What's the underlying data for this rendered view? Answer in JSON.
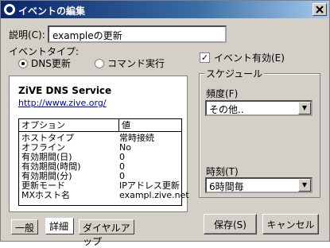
{
  "window": {
    "title": "イベントの編集"
  },
  "description": {
    "label": "説明(C):",
    "value": "exampleの更新"
  },
  "event_type": {
    "label": "イベントタイプ:",
    "options": [
      {
        "label": "DNS更新",
        "selected": true
      },
      {
        "label": "コマンド実行",
        "selected": false
      }
    ]
  },
  "event_enabled": {
    "label": "イベント有効(E)",
    "checked": true
  },
  "schedule": {
    "title": "スケジュール",
    "frequency_label": "頻度(F)",
    "frequency_value": "その他..",
    "time_label": "時刻(T)",
    "time_value": "6時間毎"
  },
  "service": {
    "name": "ZiVE DNS Service",
    "url": "http://www.zive.org/",
    "columns": [
      "オプション",
      "値"
    ],
    "rows": [
      {
        "k": "ホストタイプ",
        "v": "常時接続"
      },
      {
        "k": "オフライン",
        "v": "No"
      },
      {
        "k": "有効期間(日)",
        "v": "0"
      },
      {
        "k": "有効期間(時間)",
        "v": "0"
      },
      {
        "k": "有効期間(分)",
        "v": "0"
      },
      {
        "k": "更新モード",
        "v": "IPアドレス更新"
      },
      {
        "k": "MXホスト名",
        "v": "exampl.zive.net"
      }
    ]
  },
  "tabs": [
    {
      "label": "一般",
      "active": false
    },
    {
      "label": "詳細",
      "active": true
    },
    {
      "label": "ダイヤルアップ",
      "active": false
    }
  ],
  "buttons": {
    "save": "保存(S)",
    "cancel": "キャンセル"
  }
}
